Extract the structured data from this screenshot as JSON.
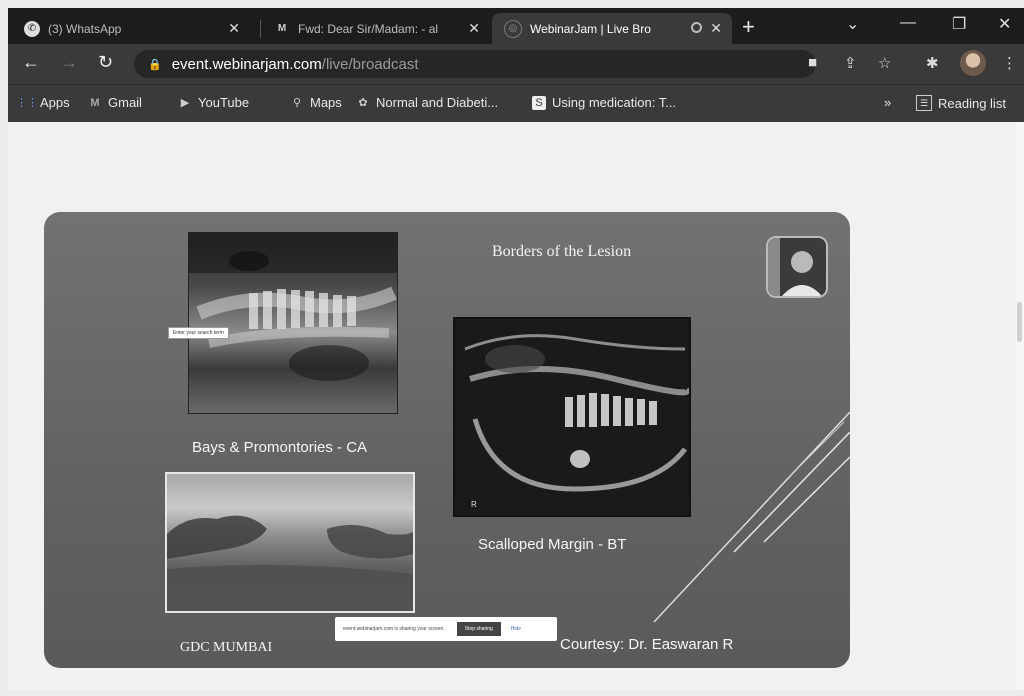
{
  "tabs": [
    {
      "title": "(3) WhatsApp",
      "icon": "whatsapp-icon"
    },
    {
      "title": "Fwd: Dear Sir/Madam: - al",
      "icon": "gmail-icon"
    },
    {
      "title": "WebinarJam | Live Bro",
      "icon": "webinarjam-icon"
    }
  ],
  "address": {
    "domain": "event.webinarjam.com",
    "path": "/live/broadcast"
  },
  "bookmarks": [
    {
      "label": "Apps",
      "icon": "apps-grid-icon"
    },
    {
      "label": "Gmail",
      "icon": "gmail-icon"
    },
    {
      "label": "YouTube",
      "icon": "youtube-icon"
    },
    {
      "label": "Maps",
      "icon": "maps-pin-icon"
    },
    {
      "label": "Normal and Diabeti...",
      "icon": "site-icon"
    },
    {
      "label": "Using medication: T...",
      "icon": "site-icon"
    }
  ],
  "reading_list": "Reading list",
  "more_bookmarks": "»",
  "slide": {
    "title": "Borders of the Lesion",
    "caption_bays": "Bays & Promontories - CA",
    "caption_scalloped": "Scalloped Margin - BT",
    "footer_left": "GDC MUMBAI",
    "footer_right": "Courtesy: Dr. Easwaran R",
    "xray_marker": "R",
    "tooltip": "Enter your search term"
  },
  "share_bar": {
    "message": "event.webinarjam.com is sharing your screen.",
    "stop_label": "Stop sharing",
    "hide_label": "Hide"
  }
}
